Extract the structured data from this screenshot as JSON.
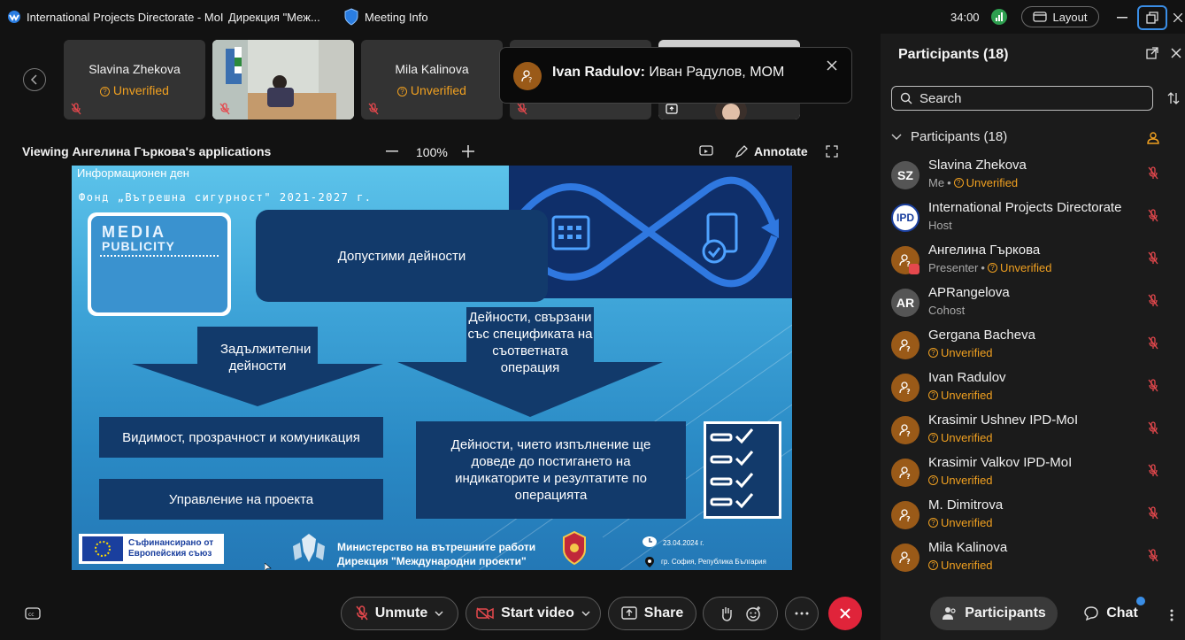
{
  "topbar": {
    "tab1": "International Projects Directorate - MoI",
    "tab2": "Дирекция \"Меж...",
    "meeting_info": "Meeting Info",
    "timer": "34:00",
    "layout": "Layout"
  },
  "thumbnails": [
    {
      "name": "Slavina Zhekova",
      "status": "Unverified"
    },
    {
      "name": "",
      "status": ""
    },
    {
      "name": "Mila Kalinova",
      "status": "Unverified"
    }
  ],
  "notification": {
    "sender": "Ivan Radulov:",
    "message": "Иван Радулов, МОМ"
  },
  "viewer": {
    "title": "Viewing Ангелина Гъркова's applications",
    "zoom": "100%",
    "annotate": "Annotate"
  },
  "slide": {
    "header1": "Информационен ден",
    "header2": "Фонд „Вътрешна сигурност\" 2021-2027 г.",
    "logo_line1": "MEDIA",
    "logo_line2": "PUBLICITY",
    "box_main": "Допустими дейности",
    "arrow_left": "Задължителни дейности",
    "arrow_right": "Дейности, свързани със спецификата на съответната операция",
    "box_visibility": "Видимост, прозрачност и комуникация",
    "box_management": "Управление на проекта",
    "box_indicators": "Дейности, чието изпълнение ще доведе до постигането на индикаторите и резултатите по операцията",
    "eu_line1": "Съфинансирано от",
    "eu_line2": "Европейския съюз",
    "ministry_line1": "Министерство на вътрешните работи",
    "ministry_line2": "Дирекция \"Международни проекти\"",
    "date": "23.04.2024 г.",
    "place": "гр. София, Република България"
  },
  "panel": {
    "title": "Participants (18)",
    "search_placeholder": "Search",
    "group_label": "Participants (18)",
    "participants": [
      {
        "initials": "SZ",
        "name": "Slavina Zhekova",
        "role": "Me",
        "status": "Unverified",
        "avatar_color": "#555555"
      },
      {
        "initials": "IPD",
        "name": "International Projects Directorate",
        "role": "Host",
        "status": "",
        "avatar_color": "#ffffff"
      },
      {
        "initials": "",
        "name": "Ангелина Гъркова",
        "role": "Presenter",
        "status": "Unverified",
        "avatar_color": "#9a5a18"
      },
      {
        "initials": "AR",
        "name": "APRangelova",
        "role": "Cohost",
        "status": "",
        "avatar_color": "#555555"
      },
      {
        "initials": "",
        "name": "Gergana Bacheva",
        "role": "",
        "status": "Unverified",
        "avatar_color": "#9a5a18"
      },
      {
        "initials": "",
        "name": "Ivan Radulov",
        "role": "",
        "status": "Unverified",
        "avatar_color": "#9a5a18"
      },
      {
        "initials": "",
        "name": "Krasimir Ushnev IPD-MoI",
        "role": "",
        "status": "Unverified",
        "avatar_color": "#9a5a18"
      },
      {
        "initials": "",
        "name": "Krasimir Valkov IPD-MoI",
        "role": "",
        "status": "Unverified",
        "avatar_color": "#9a5a18"
      },
      {
        "initials": "",
        "name": "M. Dimitrova",
        "role": "",
        "status": "Unverified",
        "avatar_color": "#9a5a18"
      },
      {
        "initials": "",
        "name": "Mila Kalinova",
        "role": "",
        "status": "Unverified",
        "avatar_color": "#9a5a18"
      }
    ]
  },
  "controls": {
    "unmute": "Unmute",
    "start_video": "Start video",
    "share": "Share",
    "participants": "Participants",
    "chat": "Chat"
  },
  "colors": {
    "accent_orange": "#f0a020",
    "end_red": "#e0243a",
    "mute_red": "#e5484d",
    "slide_dark": "#123a6b"
  }
}
